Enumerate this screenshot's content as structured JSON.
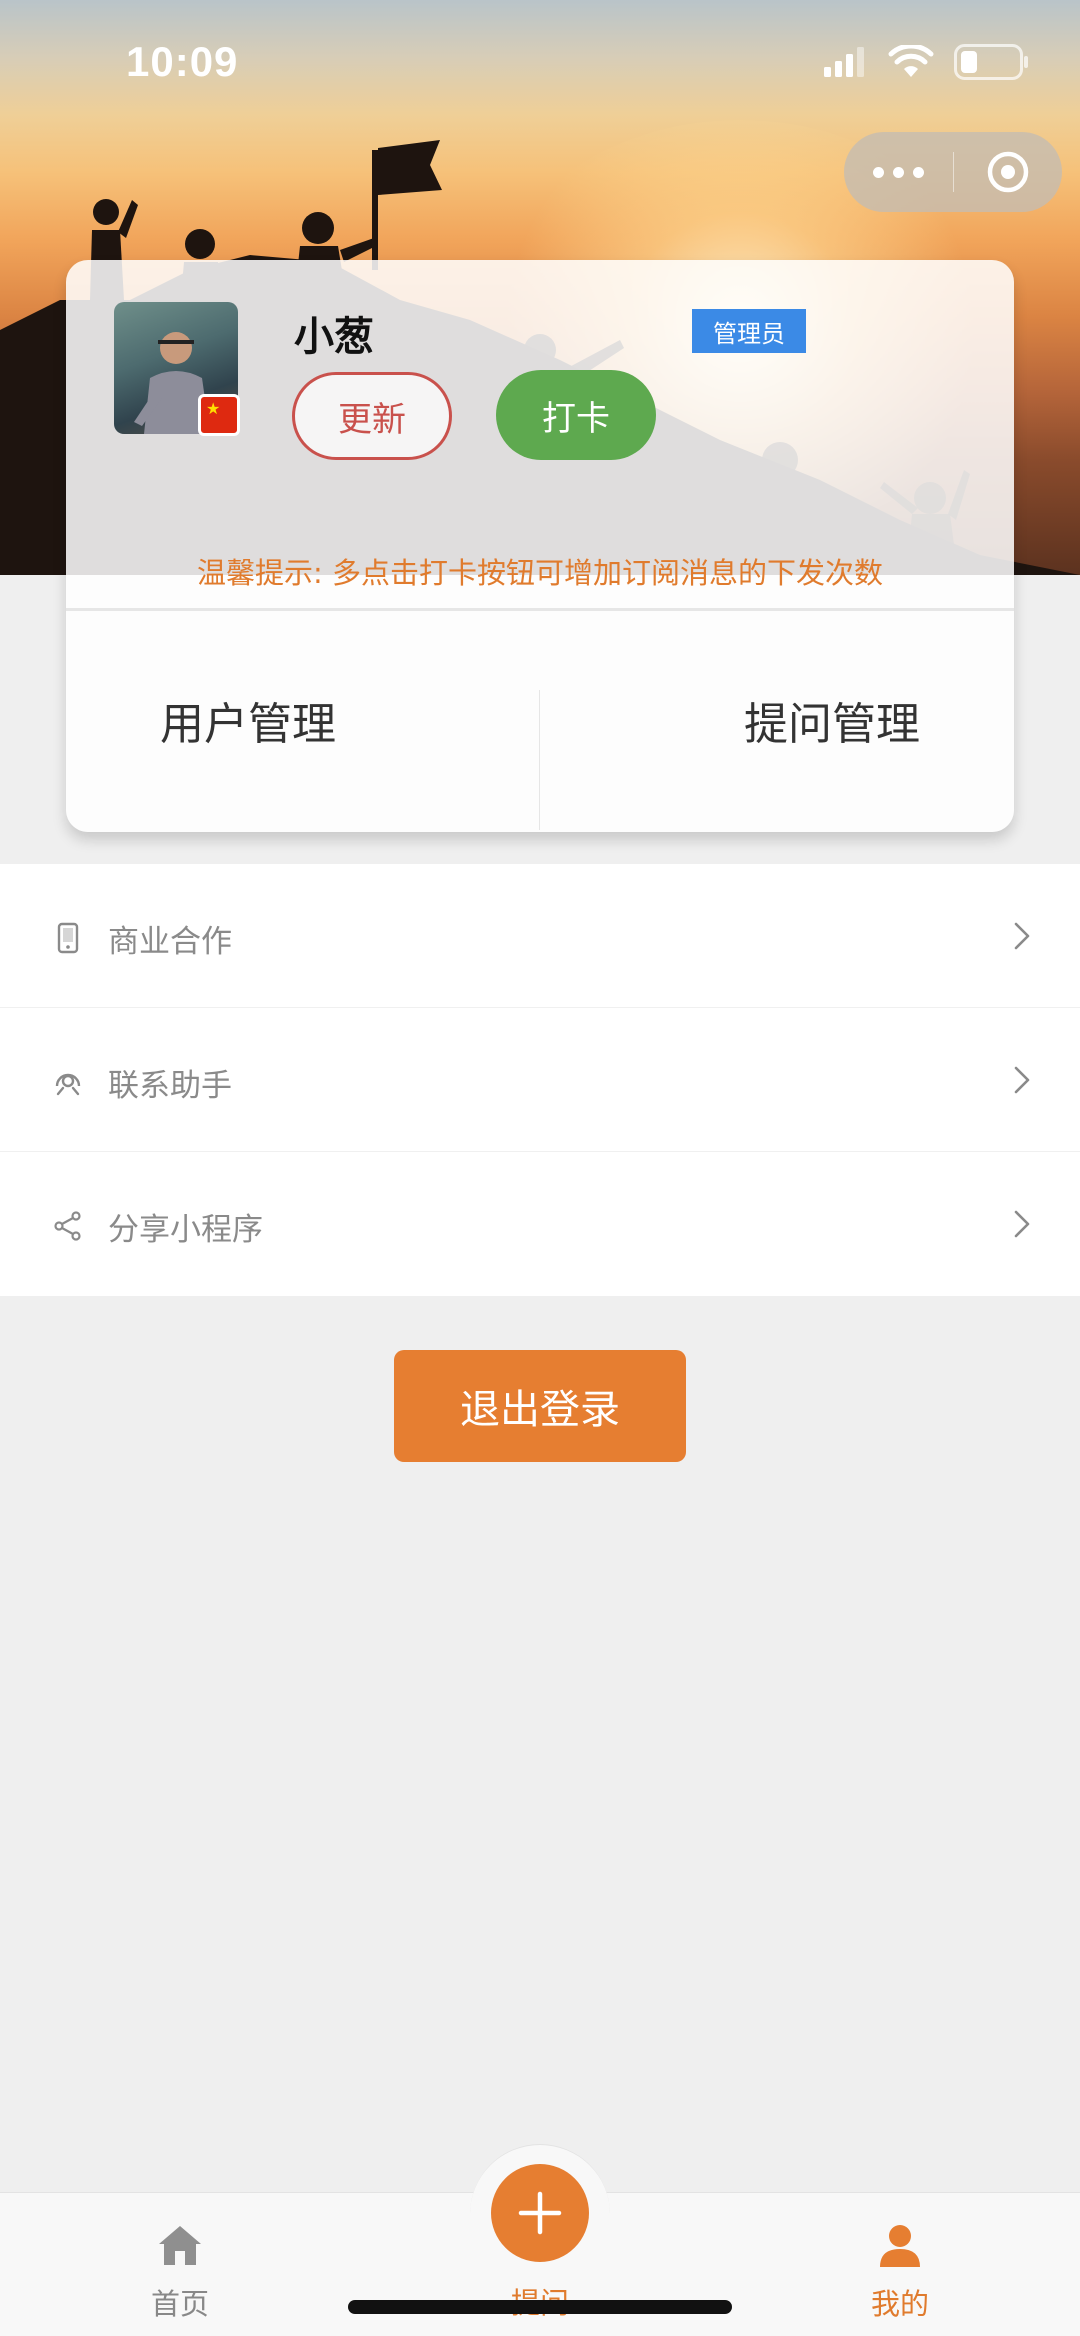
{
  "status_bar": {
    "time": "10:09"
  },
  "capsule": {
    "more_icon": "more-dots-icon",
    "close_icon": "target-close-icon"
  },
  "profile": {
    "name": "小葱",
    "role": "管理员",
    "update_label": "更新",
    "checkin_label": "打卡",
    "tip": "温馨提示: 多点击打卡按钮可增加订阅消息的下发次数"
  },
  "admin_grid": [
    {
      "label": "用户管理"
    },
    {
      "label": "提问管理"
    }
  ],
  "menu": [
    {
      "label": "商业合作",
      "icon": "phone-icon"
    },
    {
      "label": "联系助手",
      "icon": "headset-icon"
    },
    {
      "label": "分享小程序",
      "icon": "share-icon"
    }
  ],
  "logout_label": "退出登录",
  "tabbar": {
    "home_label": "首页",
    "ask_label": "提问",
    "mine_label": "我的"
  },
  "colors": {
    "accent": "#e67e31",
    "checkin_green": "#5ea94f",
    "update_red": "#c9514c",
    "badge_blue": "#3b8ae6",
    "tip_orange": "#e07b2d"
  }
}
